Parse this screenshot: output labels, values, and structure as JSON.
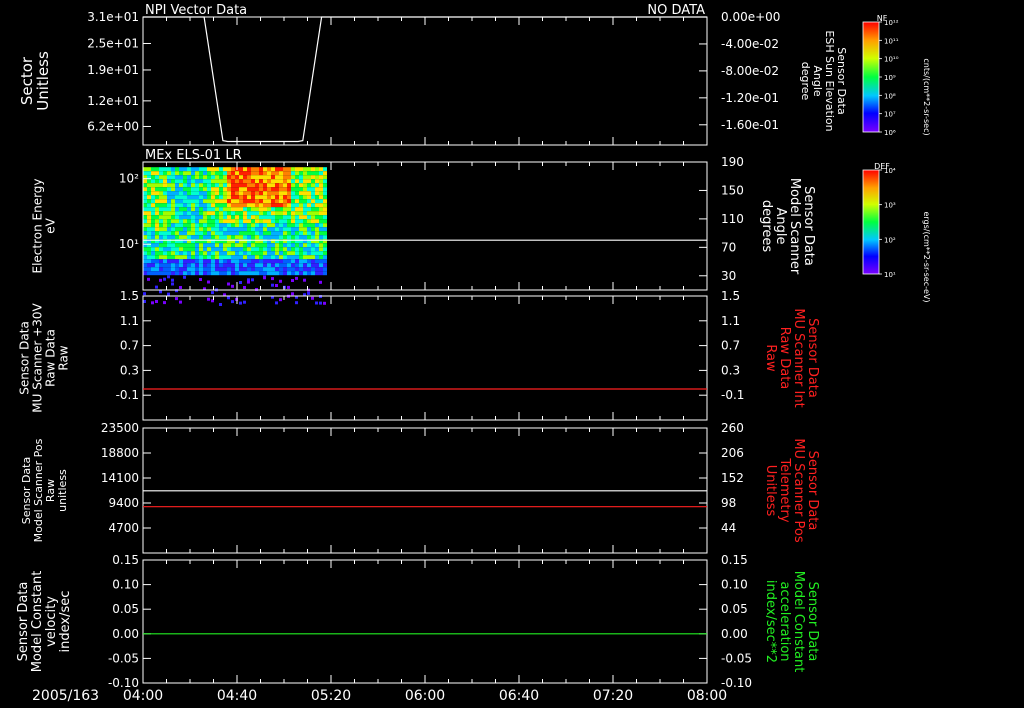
{
  "date_label": "2005/163",
  "colors": {
    "white": "#ffffff",
    "red": "#ff2020",
    "green": "#22ee22",
    "background": "#000000"
  },
  "chart_data": [
    {
      "type": "line",
      "title": "NPI Vector Data",
      "status": "NO DATA",
      "ylabel_lines": [
        "Sector",
        "Unitless"
      ],
      "ylim": [
        2.0,
        31.0
      ],
      "yticks": [
        31.0,
        25.0,
        19.0,
        12.0,
        6.2
      ],
      "ytick_labels": [
        "3.1e+01",
        "2.5e+01",
        "1.9e+01",
        "1.2e+01",
        "6.2e+00"
      ],
      "right_ylabel_lines": [
        "Sensor Data",
        "ESH Sun Elevation",
        "Angle",
        "degree"
      ],
      "right_ylim": [
        -0.19,
        0.0
      ],
      "right_yticks": [
        0.0,
        -0.04,
        -0.08,
        -0.12,
        -0.16
      ],
      "right_ytick_labels": [
        "0.00e+00",
        "-4.00e-02",
        "-8.00e-02",
        "-1.20e-01",
        "-1.60e-01"
      ],
      "series": [
        {
          "color": "#ffffff",
          "x": [
            "03:50",
            "04:26",
            "04:34",
            "04:36",
            "05:06",
            "05:08",
            "05:16",
            "08:10"
          ],
          "y": [
            31.5,
            31.5,
            3.0,
            2.8,
            2.8,
            3.0,
            31.5,
            31.5
          ]
        }
      ]
    },
    {
      "type": "heatmap",
      "title": "MEx ELS-01 LR",
      "ylabel_lines": [
        "Electron Energy",
        "eV"
      ],
      "y_scale": "log",
      "ylim": [
        2.0,
        180.0
      ],
      "yticks": [
        100,
        10
      ],
      "ytick_labels": [
        "10²",
        "10¹"
      ],
      "right_ylabel_lines": [
        "Sensor Data",
        "Model Scanner",
        "Angle",
        "degrees"
      ],
      "right_ylim": [
        10,
        190
      ],
      "right_yticks": [
        190,
        150,
        110,
        70,
        30
      ],
      "right_ytick_labels": [
        "190",
        "150",
        "110",
        "70",
        "30"
      ],
      "data_time_range": [
        "04:00",
        "05:17"
      ],
      "series": [
        {
          "color": "#ffffff",
          "axis": "right",
          "x": [
            "04:00",
            "08:00"
          ],
          "y": [
            80,
            80
          ]
        }
      ]
    },
    {
      "type": "line",
      "ylabel_lines": [
        "Sensor Data",
        "MU Scanner +30V",
        "Raw Data",
        "Raw"
      ],
      "ylim": [
        -0.5,
        1.5
      ],
      "yticks": [
        1.5,
        1.1,
        0.7,
        0.3,
        -0.1
      ],
      "ytick_labels": [
        "1.5",
        "1.1",
        "0.7",
        "0.3",
        "-0.1"
      ],
      "right_ylabel_lines": [
        "Sensor Data",
        "MU Scanner Int",
        "Raw Data",
        "Raw"
      ],
      "right_ylim": [
        -0.5,
        1.5
      ],
      "right_yticks": [
        1.5,
        1.1,
        0.7,
        0.3,
        -0.1
      ],
      "right_ytick_labels": [
        "1.5",
        "1.1",
        "0.7",
        "0.3",
        "-0.1"
      ],
      "series": [
        {
          "color": "#ff2020",
          "axis": "right",
          "x": [
            "04:00",
            "08:00"
          ],
          "y": [
            0.0,
            0.0
          ]
        }
      ]
    },
    {
      "type": "line",
      "ylabel_lines": [
        "Sensor Data",
        "Model Scanner Pos",
        "Raw",
        "unitless"
      ],
      "ylim": [
        0,
        23500
      ],
      "yticks": [
        23500,
        18800,
        14100,
        9400,
        4700
      ],
      "ytick_labels": [
        "23500",
        "18800",
        "14100",
        "9400",
        "4700"
      ],
      "right_ylabel_lines": [
        "Sensor Data",
        "MU Scanner Pos",
        "Telemetry",
        "Unitless"
      ],
      "right_ylim": [
        -10,
        260
      ],
      "right_yticks": [
        260,
        206,
        152,
        98,
        44
      ],
      "right_ytick_labels": [
        "260",
        "206",
        "152",
        "98",
        "44"
      ],
      "series": [
        {
          "color": "#ffffff",
          "axis": "left",
          "x": [
            "04:00",
            "08:00"
          ],
          "y": [
            11700,
            11700
          ]
        },
        {
          "color": "#ff2020",
          "axis": "right",
          "x": [
            "04:00",
            "08:00"
          ],
          "y": [
            90,
            90
          ]
        }
      ]
    },
    {
      "type": "line",
      "ylabel_lines": [
        "Sensor Data",
        "Model Constant",
        "velocity",
        "index/sec"
      ],
      "ylim": [
        -0.1,
        0.15
      ],
      "yticks": [
        0.15,
        0.1,
        0.05,
        0.0,
        -0.05,
        -0.1
      ],
      "ytick_labels": [
        "0.15",
        "0.10",
        "0.05",
        "0.00",
        "-0.05",
        "-0.10"
      ],
      "right_ylabel_lines": [
        "Sensor Data",
        "Model Constant",
        "acceleration",
        "index/sec**2"
      ],
      "right_ylim": [
        -0.1,
        0.15
      ],
      "right_yticks": [
        0.15,
        0.1,
        0.05,
        0.0,
        -0.05,
        -0.1
      ],
      "right_ytick_labels": [
        "0.15",
        "0.10",
        "0.05",
        "0.00",
        "-0.05",
        "-0.10"
      ],
      "series": [
        {
          "color": "#22ee22",
          "axis": "left",
          "x": [
            "04:00",
            "08:00"
          ],
          "y": [
            0.0,
            0.0
          ]
        }
      ]
    }
  ],
  "x_axis": {
    "range": [
      "04:00",
      "08:00"
    ],
    "ticks": [
      "04:00",
      "04:40",
      "05:20",
      "06:00",
      "06:40",
      "07:20",
      "08:00"
    ]
  },
  "colorbars": [
    {
      "label": "NF",
      "units": "cnts/(cm**2-sr-sec)",
      "tick_labels": [
        "10¹²",
        "10¹¹",
        "10¹⁰",
        "10⁹",
        "10⁸",
        "10⁷",
        "10⁶"
      ]
    },
    {
      "label": "DEF",
      "units": "ergs/(cm**2-sr-sec-eV)",
      "tick_labels": [
        "10⁴",
        "10³",
        "10²",
        "10¹"
      ]
    }
  ]
}
